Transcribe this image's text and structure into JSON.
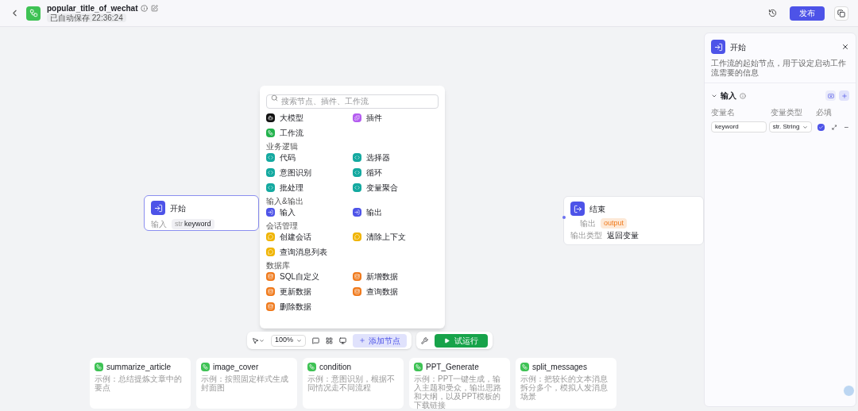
{
  "header": {
    "title": "popular_title_of_wechat",
    "autosave": "已自动保存 22:36:24",
    "publish": "发布"
  },
  "start_node": {
    "title": "开始",
    "field_label": "输入",
    "var_type": "str",
    "var_name": "keyword",
    "selected": true
  },
  "end_node": {
    "title": "结束",
    "output_label": "输出",
    "output_tag": "output",
    "type_label": "输出类型",
    "type_value": "返回变量"
  },
  "node_menu": {
    "search": {
      "placeholder": "搜索节点、插件、工作流"
    },
    "sections": [
      {
        "items": [
          {
            "label": "大模型",
            "kind": "model"
          },
          {
            "label": "插件",
            "kind": "plugin"
          },
          {
            "label": "工作流",
            "kind": "workflow"
          }
        ]
      },
      {
        "title": "业务逻辑",
        "items": [
          {
            "label": "代码",
            "kind": "logic"
          },
          {
            "label": "选择器",
            "kind": "logic"
          },
          {
            "label": "意图识别",
            "kind": "logic"
          },
          {
            "label": "循环",
            "kind": "logic"
          },
          {
            "label": "批处理",
            "kind": "logic"
          },
          {
            "label": "变量聚合",
            "kind": "logic"
          }
        ]
      },
      {
        "title": "输入&输出",
        "items": [
          {
            "label": "输入",
            "kind": "io"
          },
          {
            "label": "输出",
            "kind": "io"
          }
        ]
      },
      {
        "title": "会话管理",
        "items": [
          {
            "label": "创建会话",
            "kind": "chat"
          },
          {
            "label": "清除上下文",
            "kind": "chat"
          },
          {
            "label": "查询消息列表",
            "kind": "chat"
          }
        ]
      },
      {
        "title": "数据库",
        "items": [
          {
            "label": "SQL自定义",
            "kind": "db"
          },
          {
            "label": "新增数据",
            "kind": "db"
          },
          {
            "label": "更新数据",
            "kind": "db"
          },
          {
            "label": "查询数据",
            "kind": "db"
          },
          {
            "label": "删除数据",
            "kind": "db"
          }
        ]
      }
    ]
  },
  "toolbar": {
    "zoom": "100%",
    "add_node": "添加节点",
    "test_run": "试运行"
  },
  "templates": [
    {
      "title": "summarize_article",
      "description": "示例：总结提炼文章中的要点"
    },
    {
      "title": "image_cover",
      "description": "示例：按照固定样式生成封面图"
    },
    {
      "title": "condition",
      "description": "示例：意图识别，根据不同情况走不同流程"
    },
    {
      "title": "PPT_Generate",
      "description": "示例：PPT一键生成，输入主题和受众，输出思路和大纲，以及PPT模板的下载链接"
    },
    {
      "title": "split_messages",
      "description": "示例：把较长的文本消息拆分多个，模拟人发消息场景"
    }
  ],
  "side_panel": {
    "title": "开始",
    "description": "工作流的起始节点，用于设定启动工作流需要的信息",
    "section": "输入",
    "columns": [
      "变量名",
      "变量类型",
      "必填"
    ],
    "rows": [
      {
        "name": "keyword",
        "type": "str. String",
        "required": true
      }
    ]
  }
}
